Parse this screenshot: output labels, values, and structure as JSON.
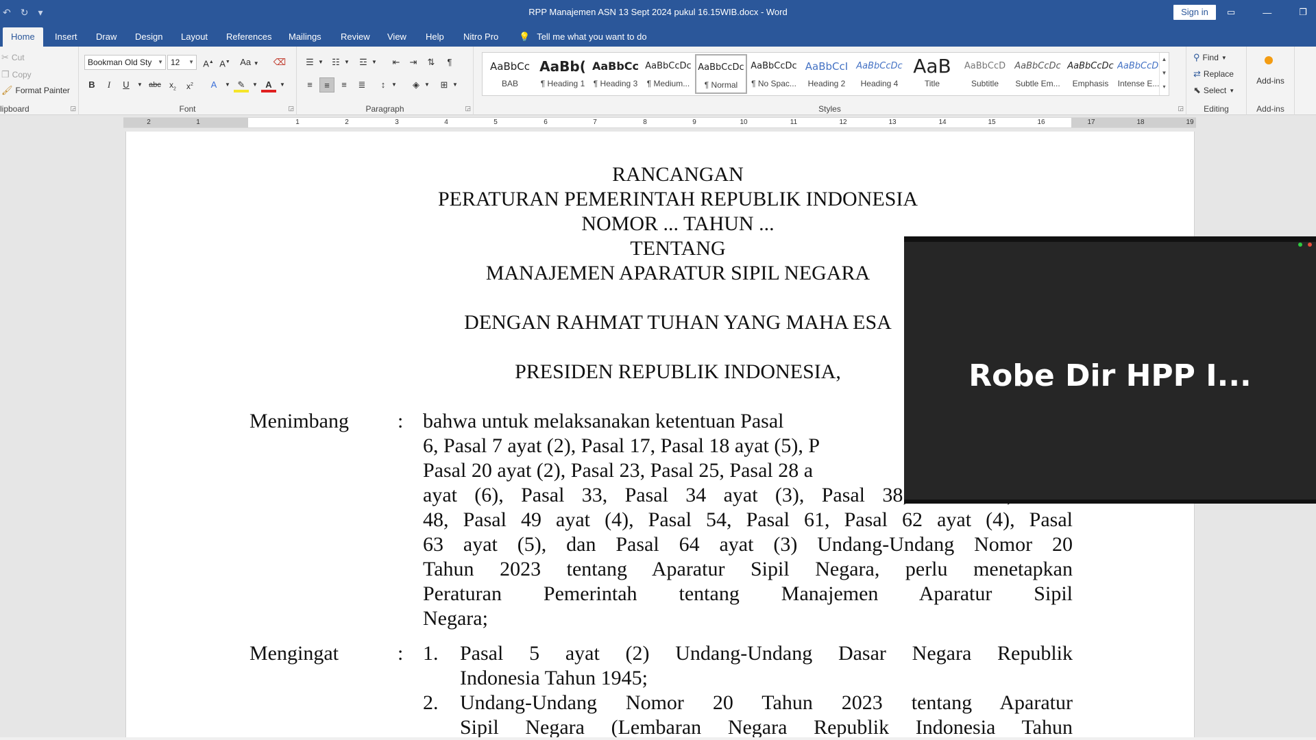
{
  "window": {
    "title": "RPP Manajemen ASN 13 Sept 2024 pukul 16.15WIB.docx  -  Word",
    "sign_in": "Sign in"
  },
  "tabs": [
    {
      "label": "Home",
      "active": true
    },
    {
      "label": "Insert"
    },
    {
      "label": "Draw"
    },
    {
      "label": "Design"
    },
    {
      "label": "Layout"
    },
    {
      "label": "References"
    },
    {
      "label": "Mailings"
    },
    {
      "label": "Review"
    },
    {
      "label": "View"
    },
    {
      "label": "Help"
    },
    {
      "label": "Nitro Pro"
    }
  ],
  "tell_me": "Tell me what you want to do",
  "clipboard": {
    "cut": "Cut",
    "copy": "Copy",
    "format_painter": "Format Painter",
    "label": "lipboard"
  },
  "font": {
    "name": "Bookman Old Sty",
    "size": "12",
    "label": "Font",
    "change_case": "Aa"
  },
  "paragraph": {
    "label": "Paragraph"
  },
  "styles": {
    "label": "Styles",
    "items": [
      {
        "sample": "AaBbCc",
        "name": "BAB"
      },
      {
        "sample": "AaBb(",
        "name": "¶ Heading 1"
      },
      {
        "sample": "AaBbCc",
        "name": "¶ Heading 3"
      },
      {
        "sample": "AaBbCcDc",
        "name": "¶ Medium..."
      },
      {
        "sample": "AaBbCcDc",
        "name": "¶ Normal",
        "selected": true
      },
      {
        "sample": "AaBbCcDc",
        "name": "¶ No Spac..."
      },
      {
        "sample": "AaBbCcI",
        "name": "Heading 2"
      },
      {
        "sample": "AaBbCcDc",
        "name": "Heading 4"
      },
      {
        "sample": "AaB",
        "name": "Title"
      },
      {
        "sample": "AaBbCcD",
        "name": "Subtitle"
      },
      {
        "sample": "AaBbCcDc",
        "name": "Subtle Em..."
      },
      {
        "sample": "AaBbCcDc",
        "name": "Emphasis"
      },
      {
        "sample": "AaBbCcDc",
        "name": "Intense E..."
      }
    ]
  },
  "editing": {
    "find": "Find",
    "replace": "Replace",
    "select": "Select",
    "label": "Editing"
  },
  "addins": {
    "button": "Add-ins",
    "label": "Add-ins"
  },
  "ruler": {
    "ticks": [
      "2",
      "1",
      "1",
      "2",
      "3",
      "4",
      "5",
      "6",
      "7",
      "8",
      "9",
      "10",
      "11",
      "12",
      "13",
      "14",
      "15",
      "16",
      "17",
      "18",
      "19"
    ]
  },
  "document": {
    "heading": [
      "RANCANGAN",
      "PERATURAN PEMERINTAH REPUBLIK INDONESIA",
      "NOMOR ... TAHUN ...",
      "TENTANG",
      "MANAJEMEN APARATUR SIPIL NEGARA"
    ],
    "rahmat": "DENGAN RAHMAT TUHAN YANG MAHA ESA",
    "presiden": "PRESIDEN REPUBLIK INDONESIA,",
    "menimbang_label": "Menimbang",
    "colon": ":",
    "menimbang_lines": [
      "bahwa untuk  melaksanakan ketentuan Pasal",
      "6, Pasal 7 ayat (2), Pasal 17, Pasal 18 ayat (5), P",
      "Pasal 20 ayat (2), Pasal 23, Pasal 25, Pasal 28 a",
      "ayat (6), Pasal 33, Pasal 34 ayat (3), Pasal 38, Pasal 45, Pasal",
      "48, Pasal 49 ayat (4), Pasal 54, Pasal 61, Pasal 62 ayat (4), Pasal",
      "63 ayat (5), dan Pasal 64 ayat (3) Undang-Undang Nomor 20",
      "Tahun 2023 tentang Aparatur Sipil Negara, perlu menetapkan",
      "Peraturan Pemerintah tentang Manajemen Aparatur Sipil",
      "Negara;"
    ],
    "mengingat_label": "Mengingat",
    "mengingat_items": [
      {
        "num": "1.",
        "lines": [
          "Pasal 5 ayat (2) Undang-Undang Dasar Negara Republik",
          "Indonesia Tahun 1945;"
        ]
      },
      {
        "num": "2.",
        "lines": [
          "Undang-Undang Nomor 20 Tahun 2023 tentang Aparatur",
          "Sipil Negara (Lembaran Negara Republik Indonesia Tahun"
        ]
      }
    ]
  },
  "video": {
    "participant": "Robe Dir HPP I..."
  }
}
